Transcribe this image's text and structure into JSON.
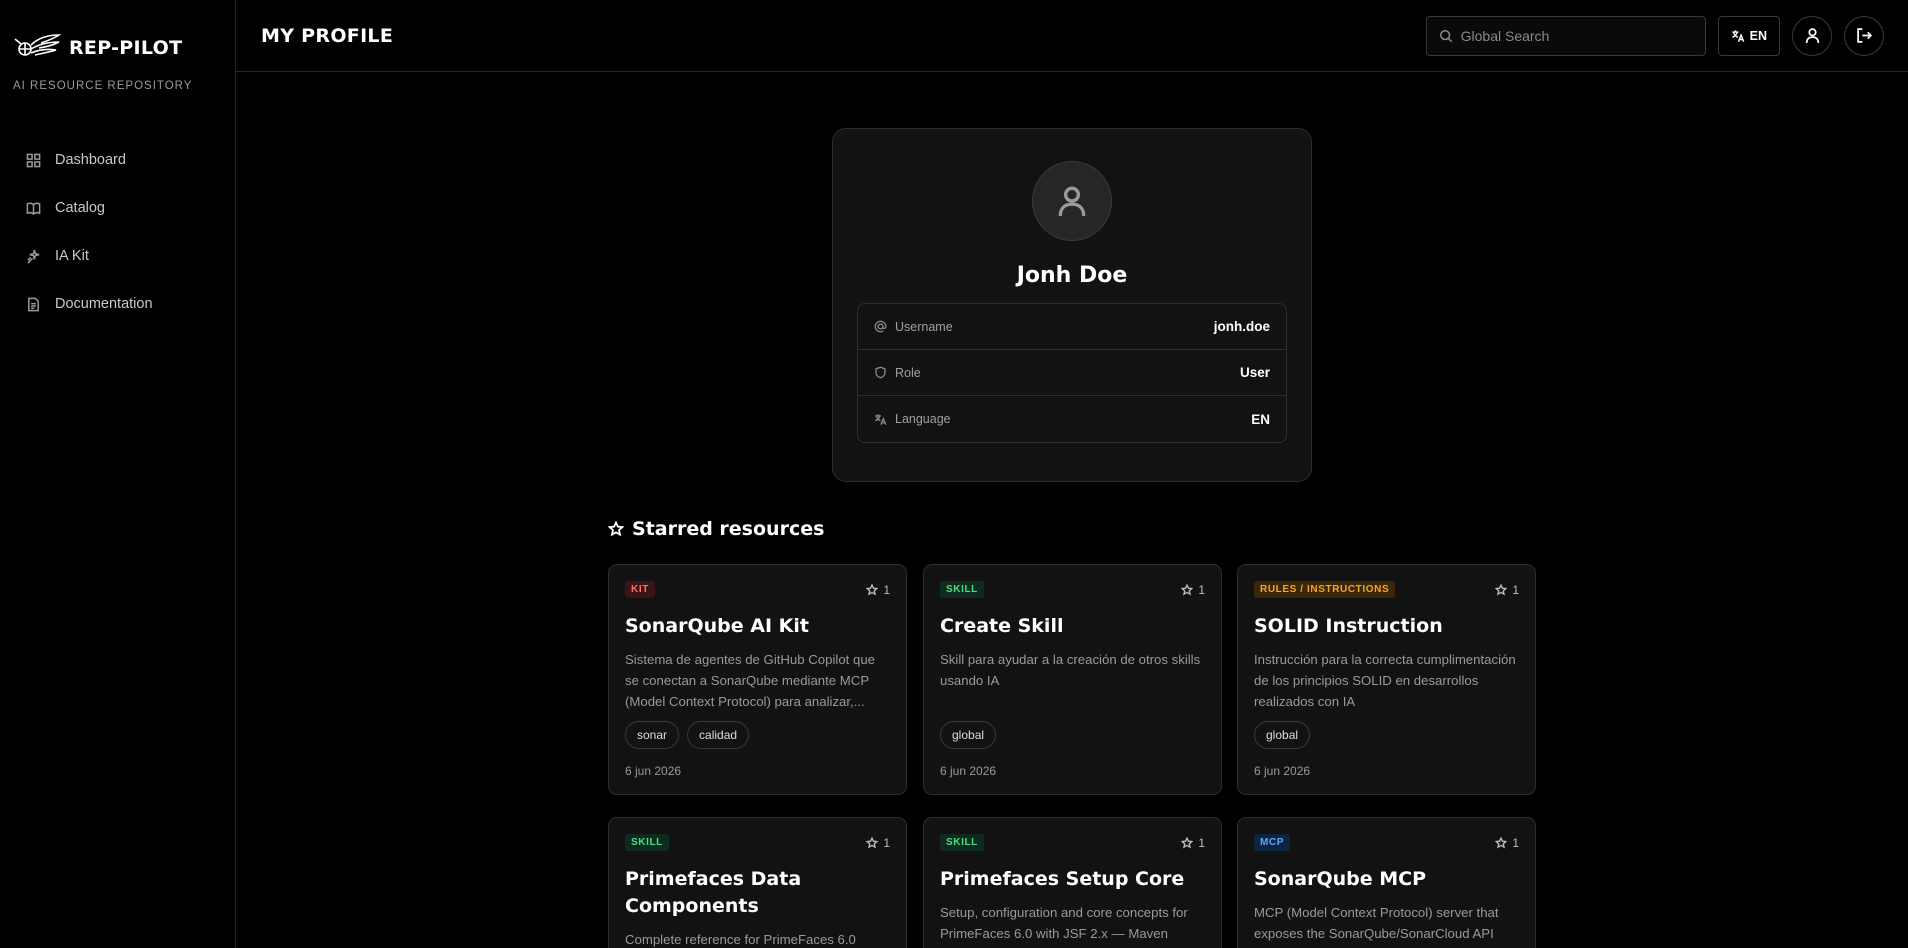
{
  "sidebar": {
    "brand_name": "REP-PILOT",
    "brand_subtitle": "AI RESOURCE REPOSITORY",
    "items": [
      {
        "label": "Dashboard",
        "icon": "grid-icon"
      },
      {
        "label": "Catalog",
        "icon": "book-icon"
      },
      {
        "label": "IA Kit",
        "icon": "sparkles-icon"
      },
      {
        "label": "Documentation",
        "icon": "document-icon"
      }
    ]
  },
  "header": {
    "title": "MY PROFILE",
    "search_placeholder": "Global Search",
    "language_label": "EN"
  },
  "profile": {
    "name": "Jonh Doe",
    "rows": [
      {
        "label": "Username",
        "value": "jonh.doe",
        "icon": "at-icon"
      },
      {
        "label": "Role",
        "value": "User",
        "icon": "shield-icon"
      },
      {
        "label": "Language",
        "value": "EN",
        "icon": "translate-icon"
      }
    ]
  },
  "starred": {
    "title": "Starred resources",
    "cards": [
      {
        "badge": "KIT",
        "stars": "1",
        "title": "SonarQube AI Kit",
        "desc": "Sistema de agentes de GitHub Copilot que se conectan a SonarQube mediante MCP (Model Context Protocol) para analizar,...",
        "tags": [
          "sonar",
          "calidad"
        ],
        "date": "6 jun 2026"
      },
      {
        "badge": "SKILL",
        "stars": "1",
        "title": "Create Skill",
        "desc": "Skill para ayudar a la creación de otros skills usando IA",
        "tags": [
          "global"
        ],
        "date": "6 jun 2026"
      },
      {
        "badge": "RULES / INSTRUCTIONS",
        "stars": "1",
        "title": "SOLID Instruction",
        "desc": "Instrucción para la correcta cumplimentación de los principios SOLID en desarrollos realizados con IA",
        "tags": [
          "global"
        ],
        "date": "6 jun 2026"
      },
      {
        "badge": "SKILL",
        "stars": "1",
        "title": "Primefaces Data Components",
        "desc": "Complete reference for PrimeFaces 6.0",
        "tags": [],
        "date": ""
      },
      {
        "badge": "SKILL",
        "stars": "1",
        "title": "Primefaces Setup Core",
        "desc": "Setup, configuration and core concepts for PrimeFaces 6.0 with JSF 2.x — Maven",
        "tags": [],
        "date": ""
      },
      {
        "badge": "MCP",
        "stars": "1",
        "title": "SonarQube MCP",
        "desc": "MCP (Model Context Protocol) server that exposes the SonarQube/SonarCloud API",
        "tags": [],
        "date": ""
      }
    ]
  }
}
